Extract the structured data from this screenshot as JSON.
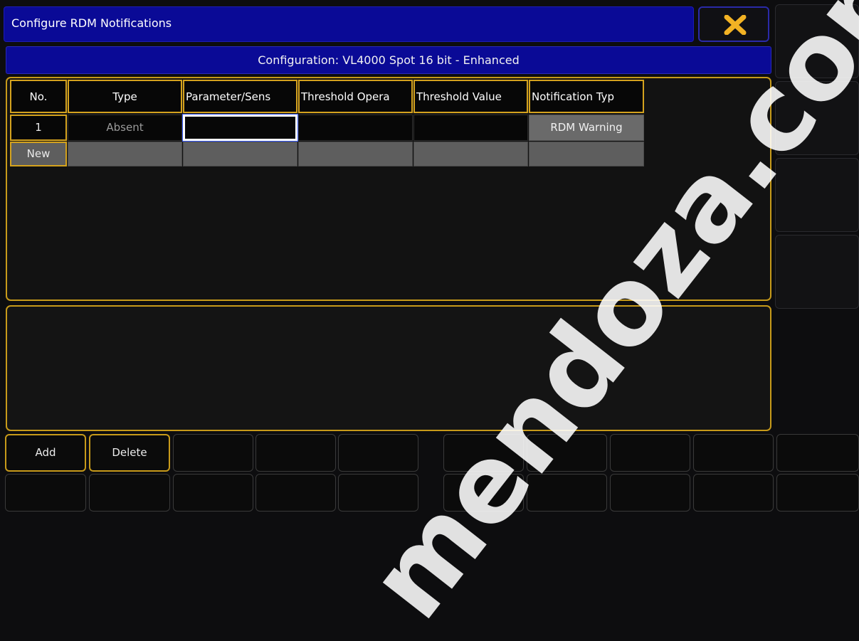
{
  "window": {
    "title": "Configure RDM Notifications",
    "close_icon": "close-icon",
    "accent_color": "#d4a21e",
    "title_bar_color": "#0a0a96"
  },
  "configuration": {
    "label": "Configuration: VL4000 Spot 16 bit - Enhanced"
  },
  "table": {
    "headers": [
      "No.",
      "Type",
      "Parameter/Sens",
      "Threshold Opera",
      "Threshold Value",
      "Notification Typ"
    ],
    "rows": [
      {
        "no": "1",
        "type": "Absent",
        "parameter": "",
        "threshold_operator": "",
        "threshold_value": "",
        "notification_type": "RDM Warning"
      }
    ],
    "new_row_label": "New"
  },
  "buttons": {
    "add": "Add",
    "delete": "Delete"
  },
  "watermark": "mendoza.com"
}
